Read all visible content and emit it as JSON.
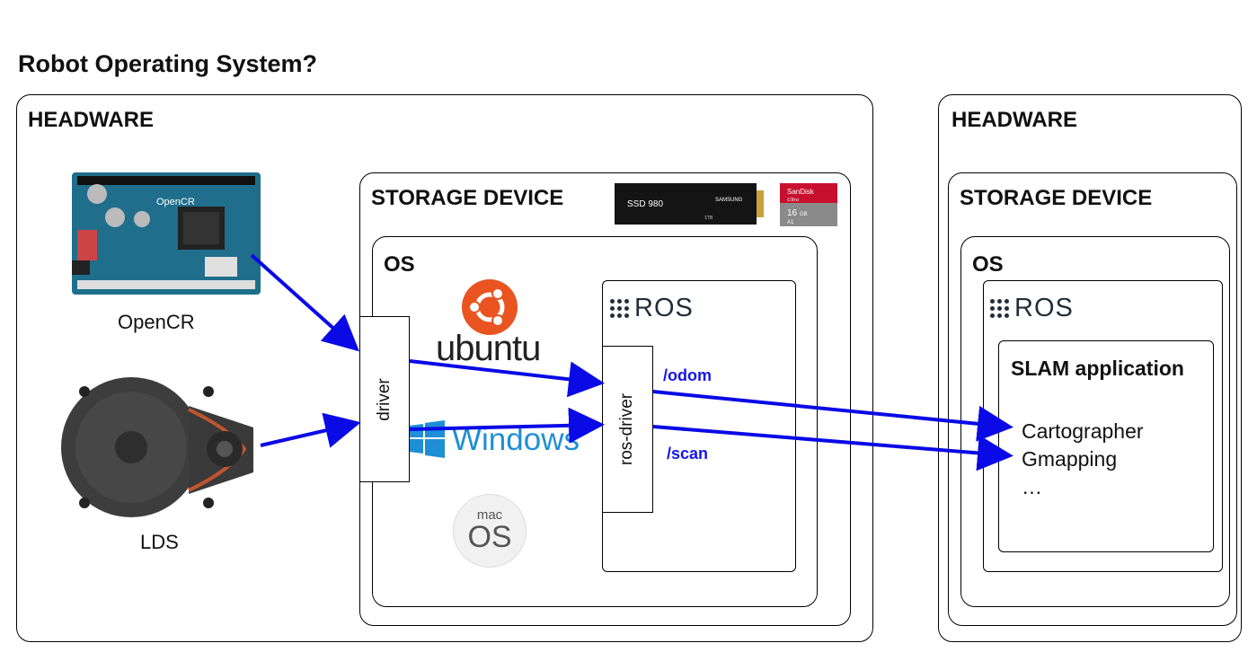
{
  "title": "Robot Operating System?",
  "left": {
    "hardware_label": "HEADWARE",
    "opencr_caption": "OpenCR",
    "lds_caption": "LDS",
    "storage_label": "STORAGE DEVICE",
    "ssd": {
      "model": "SSD 980",
      "brand": "SAMSUNG",
      "capacity": "1TB"
    },
    "sdcard": {
      "brand": "SanDisk",
      "line": "Ultra",
      "capacity": "16",
      "unit": "GB",
      "rating": "A1"
    },
    "os_label": "OS",
    "driver_label": "driver",
    "ros_label": "ROS",
    "ros_driver_label": "ros-driver",
    "ubuntu_label": "ubuntu",
    "windows_label": "Windows",
    "macos_top": "mac",
    "macos_bottom": "OS",
    "topic_odom": "/odom",
    "topic_scan": "/scan"
  },
  "right": {
    "hardware_label": "HEADWARE",
    "storage_label": "STORAGE DEVICE",
    "os_label": "OS",
    "ros_label": "ROS",
    "slam_label": "SLAM application",
    "slam_items": [
      "Cartographer",
      "Gmapping",
      "…"
    ]
  },
  "colors": {
    "arrow": "#0a0ae6",
    "ubuntu": "#e95420",
    "windows": "#1e8fd6",
    "board": "#1f6e8c",
    "ros": "#222e3a"
  }
}
